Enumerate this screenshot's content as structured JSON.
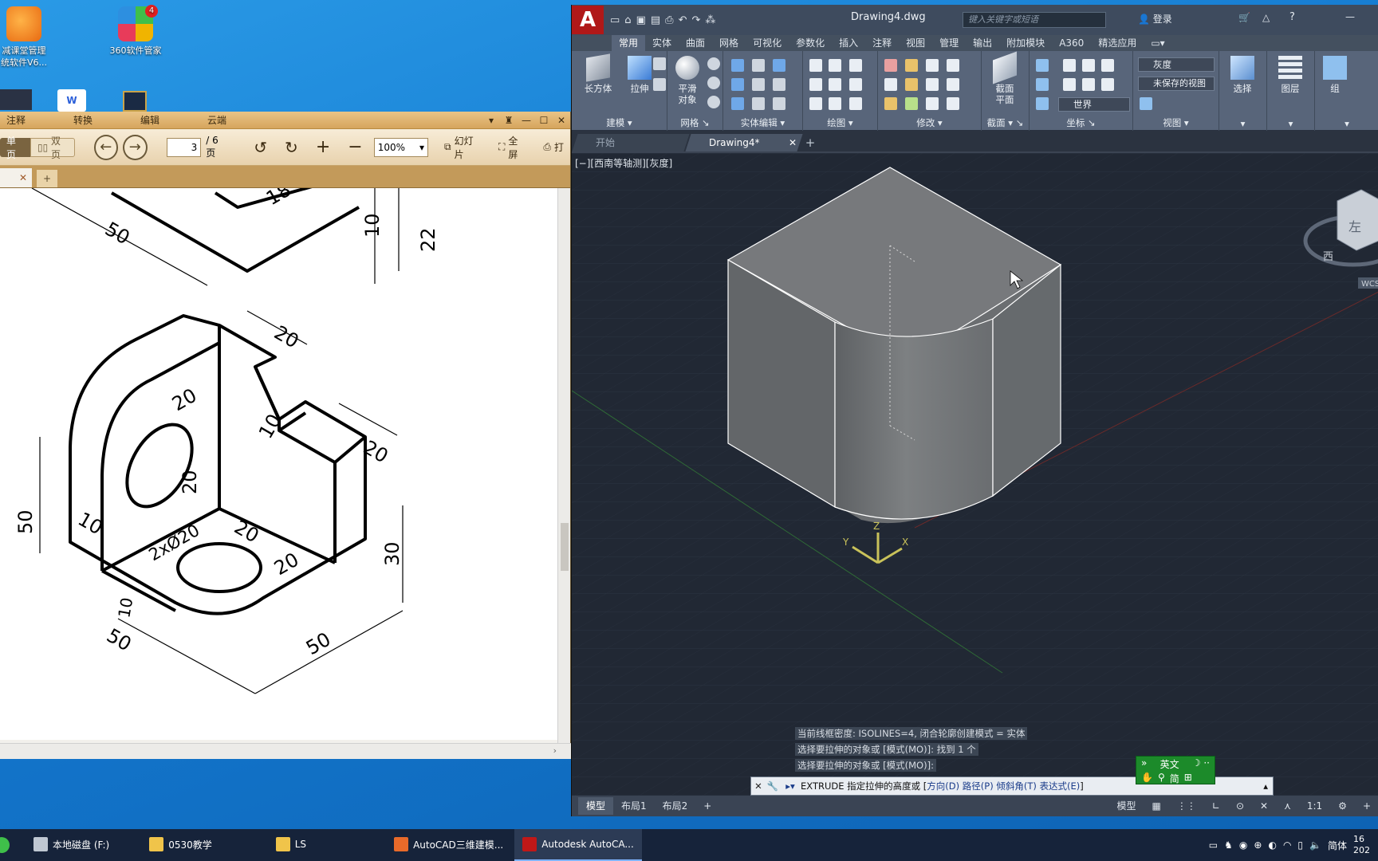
{
  "desktop": {
    "icons": [
      {
        "label_line1": "减课堂管理",
        "label_line2": "统软件V6..."
      },
      {
        "label_line1": "360软件管家",
        "label_line2": "",
        "badge": "4"
      }
    ]
  },
  "pdf": {
    "menu": [
      "注释",
      "转换",
      "编辑",
      "云端"
    ],
    "toolbar": {
      "single_page": "单页",
      "double_page": "双页",
      "page_current": "3",
      "page_total": "/ 6页",
      "zoom": "100%",
      "slideshow": "幻灯片",
      "fullscreen": "全屏",
      "print": "打"
    },
    "drawing_dims": {
      "d50a": "50",
      "d18": "18",
      "d10a": "10",
      "d22": "22",
      "d20top": "20",
      "d20hole": "20",
      "d10b": "10",
      "d20right": "20",
      "d20v": "20",
      "d10c": "10",
      "d50left": "50",
      "d20c": "20",
      "holes": "2xØ20",
      "d30": "30",
      "d20d": "20",
      "d10d": "10",
      "d50b": "50",
      "d50c": "50"
    }
  },
  "acad": {
    "logo": "A",
    "title": "Drawing4.dwg",
    "search_placeholder": "键入关键字或短语",
    "login": "登录",
    "help": "?",
    "ribbon_tabs": [
      "常用",
      "实体",
      "曲面",
      "网格",
      "可视化",
      "参数化",
      "插入",
      "注释",
      "视图",
      "管理",
      "输出",
      "附加模块",
      "A360",
      "精选应用"
    ],
    "panels": {
      "modeling": "建模",
      "mesh": "网格",
      "solid_edit": "实体编辑",
      "draw": "绘图",
      "modify": "修改",
      "section": "截面",
      "coords": "坐标",
      "view": "视图"
    },
    "tools": {
      "box": "长方体",
      "extrude": "拉伸",
      "smooth_line1": "平滑",
      "smooth_line2": "对象",
      "section_line1": "截面",
      "section_line2": "平面",
      "select": "选择",
      "layers": "图层",
      "group": "组"
    },
    "fields": {
      "visual_style": "灰度",
      "saved_view": "未保存的视图",
      "ucs": "世界"
    },
    "doc_tabs": [
      "开始",
      "Drawing4*"
    ],
    "viewport_label": "[−][西南等轴测][灰度]",
    "viewcube": {
      "face": "左",
      "compass": "西",
      "wcs": "WCS"
    },
    "ucs_icon": {
      "x": "X",
      "y": "Y",
      "z": "Z"
    },
    "command_history": [
      "当前线框密度:  ISOLINES=4, 闭合轮廓创建模式 = 实体",
      "选择要拉伸的对象或 [模式(MO)]: 找到 1 个",
      "选择要拉伸的对象或 [模式(MO)]:"
    ],
    "command_line": {
      "prefix": "EXTRUDE 指定拉伸的高度或 [",
      "opt1": "方向(D)",
      "opt2": "路径(P)",
      "opt3": "倾斜角(T)",
      "opt4": "表达式(E)",
      "suffix": "]"
    },
    "layout_tabs": [
      "模型",
      "布局1",
      "布局2"
    ],
    "status_model": "模型",
    "status_scale": "1:1"
  },
  "ime": {
    "lang": "英文",
    "mode": "简"
  },
  "taskbar": {
    "items": [
      "本地磁盘 (F:)",
      "0530教学",
      "LS",
      "AutoCAD三维建模...",
      "Autodesk AutoCA..."
    ],
    "ime": "简体",
    "clock_line1": "16",
    "clock_line2": "202"
  }
}
